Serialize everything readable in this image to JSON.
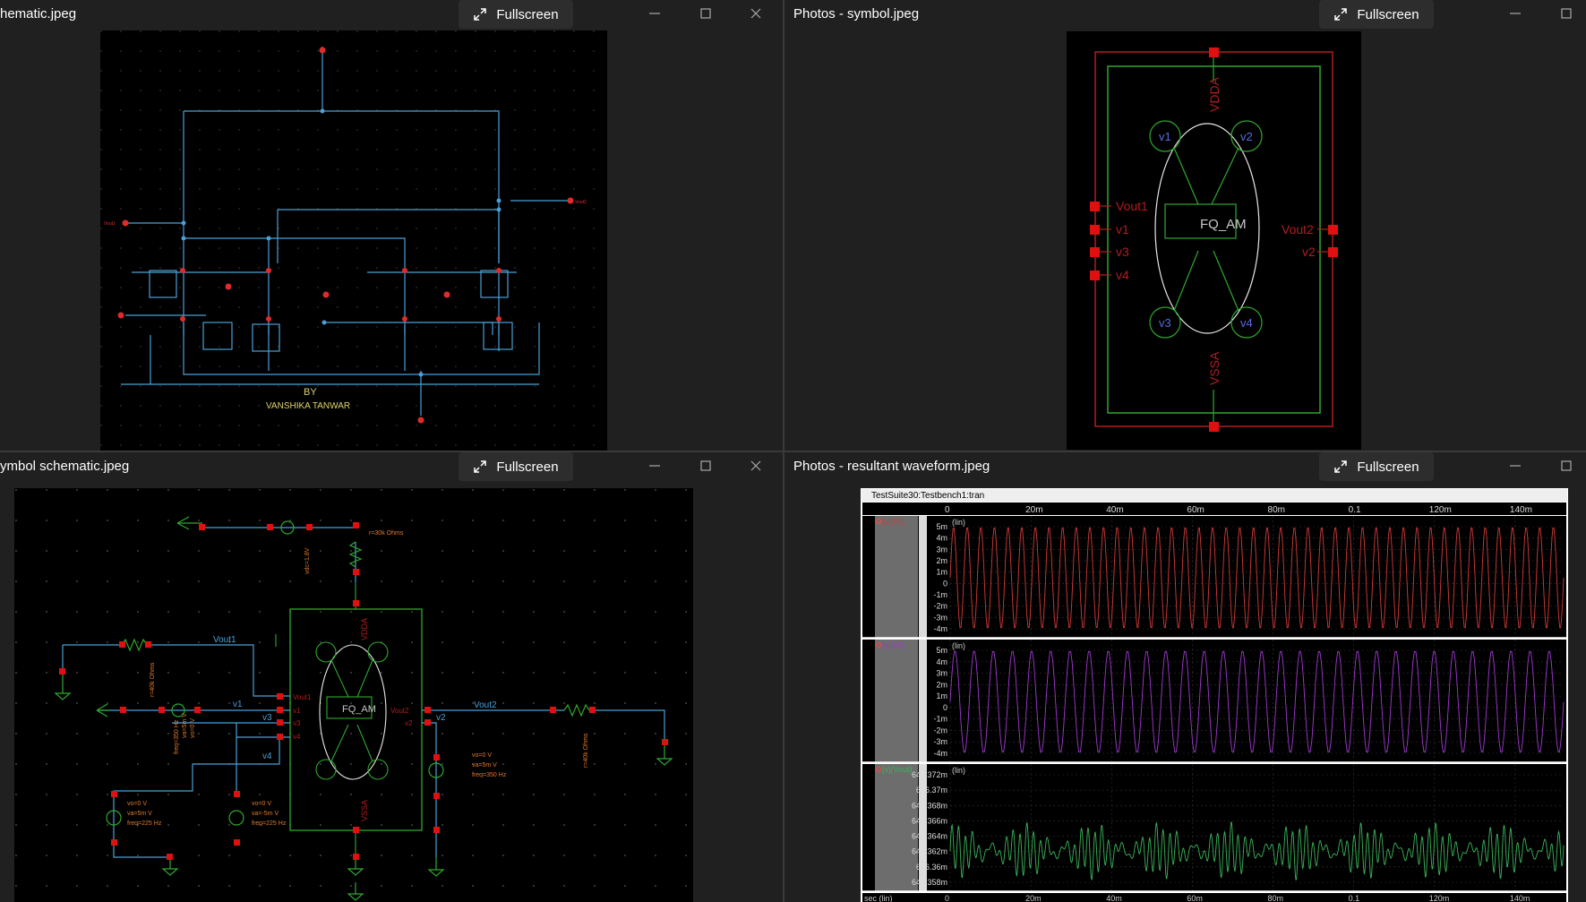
{
  "windows": {
    "top_left": {
      "title": "hematic.jpeg",
      "fullscreen_label": "Fullscreen"
    },
    "top_right": {
      "title": "Photos - symbol.jpeg",
      "fullscreen_label": "Fullscreen"
    },
    "bottom_left": {
      "title": "ymbol schematic.jpeg",
      "fullscreen_label": "Fullscreen"
    },
    "bottom_right": {
      "title": "Photos - resultant waveform.jpeg",
      "fullscreen_label": "Fullscreen"
    }
  },
  "schematic": {
    "author_line1": "BY",
    "author_line2": "VANSHIKA TANWAR",
    "label_vout1": "Vout1",
    "label_vout2": "Vout2"
  },
  "symbol": {
    "block_label": "FQ_AM",
    "vdda": "VDDA",
    "vssa": "VSSA",
    "left_pins": [
      "Vout1",
      "v1",
      "v3",
      "v4"
    ],
    "right_pins": [
      "Vout2",
      "v2"
    ],
    "nodes": [
      "v1",
      "v2",
      "v3",
      "v4"
    ]
  },
  "testbench": {
    "block_label": "FQ_AM",
    "vdda": "VDDA",
    "vssa": "VSSA",
    "net_vout1": "Vout1",
    "net_v1": "v1",
    "net_v3": "v3",
    "net_v4": "v4",
    "net_vout2": "Vout2",
    "net_v2": "v2",
    "pin_vout1": "Vout1",
    "pin_v1": "v1",
    "pin_v3": "v3",
    "pin_v4": "v4",
    "pin_vout2": "Vout2",
    "pin_v2": "v2",
    "r_top": "r=30k Ohms",
    "r_left": "r=40k Ohms",
    "r_right": "r=40k Ohms",
    "vdc": "vdc=1.8V",
    "src_v5": [
      "vo=0 V",
      "va=5m V",
      "freq=350 Hz"
    ],
    "src_v6": [
      "vo=0 V",
      "va=5m V",
      "freq=350 Hz"
    ],
    "src_v7": [
      "vo=0 V",
      "va=5m V",
      "freq=225 Hz"
    ],
    "src_v8": [
      "vo=0 V",
      "va=-5m V",
      "freq=225 Hz"
    ]
  },
  "waveform": {
    "title": "TestSuite30:Testbench1:tran",
    "x_ticks": [
      "0",
      "20m",
      "40m",
      "60m",
      "80m",
      "0.1",
      "120m",
      "140m"
    ],
    "x_label": "sec (lin)",
    "panels": [
      {
        "signal": "[v](v1)",
        "scale": "(lin)",
        "color": "#d23a3a",
        "y_ticks": [
          "5m",
          "4m",
          "3m",
          "2m",
          "1m",
          "0",
          "-1m",
          "-2m",
          "-3m",
          "-4m"
        ],
        "cycles": 45
      },
      {
        "signal": "[v](v2)",
        "scale": "(lin)",
        "color": "#a03ad2",
        "y_ticks": [
          "5m",
          "4m",
          "3m",
          "2m",
          "1m",
          "0",
          "-1m",
          "-2m",
          "-3m",
          "-4m"
        ],
        "cycles": 32
      },
      {
        "signal": "[v](Vout)",
        "scale": "(lin)",
        "color": "#3ab45a",
        "y_ticks": [
          "646.372m",
          "646.37m",
          "646.368m",
          "646.366m",
          "646.364m",
          "646.362m",
          "646.36m",
          "646.358m"
        ],
        "cycles": 90
      }
    ]
  }
}
